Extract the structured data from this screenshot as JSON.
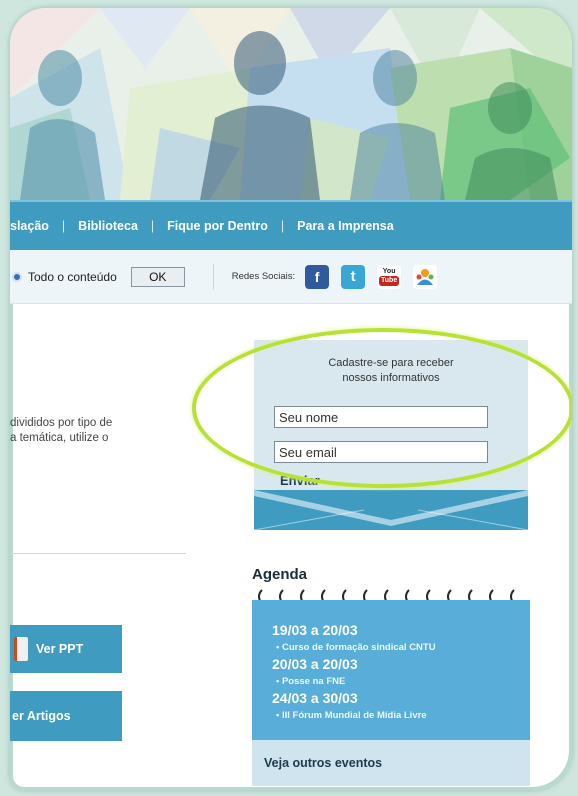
{
  "nav": {
    "items": [
      "slação",
      "Biblioteca",
      "Fique por Dentro",
      "Para a Imprensa"
    ],
    "separator": "|"
  },
  "search": {
    "radio_label": "Todo o conteúdo",
    "ok_label": "OK",
    "social_label": "Redes Sociais:"
  },
  "social": {
    "facebook": "f",
    "twitter": "t",
    "youtube_top": "You",
    "youtube_bottom": "Tube"
  },
  "intro": {
    "line1": "divididos por tipo de",
    "line2": "a temática, utilize o"
  },
  "buttons": {
    "ver_ppt": "Ver PPT",
    "ver_artigos": "er Artigos"
  },
  "newsletter": {
    "title_line1": "Cadastre-se para receber",
    "title_line2": "nossos informativos",
    "name_value": "Seu nome",
    "email_value": "Seu email",
    "submit": "Enviar"
  },
  "agenda": {
    "title": "Agenda",
    "events": [
      {
        "date": "19/03 a 20/03",
        "desc": "• Curso de formação sindical CNTU"
      },
      {
        "date": "20/03 a 20/03",
        "desc": "• Posse na FNE"
      },
      {
        "date": "24/03 a 30/03",
        "desc": "• III Fórum Mundial de Mídia Livre"
      }
    ],
    "more": "Veja outros eventos"
  },
  "colors": {
    "nav_blue": "#3f9cc0",
    "calendar_blue": "#58aed8",
    "highlight_green": "#b7e233"
  }
}
